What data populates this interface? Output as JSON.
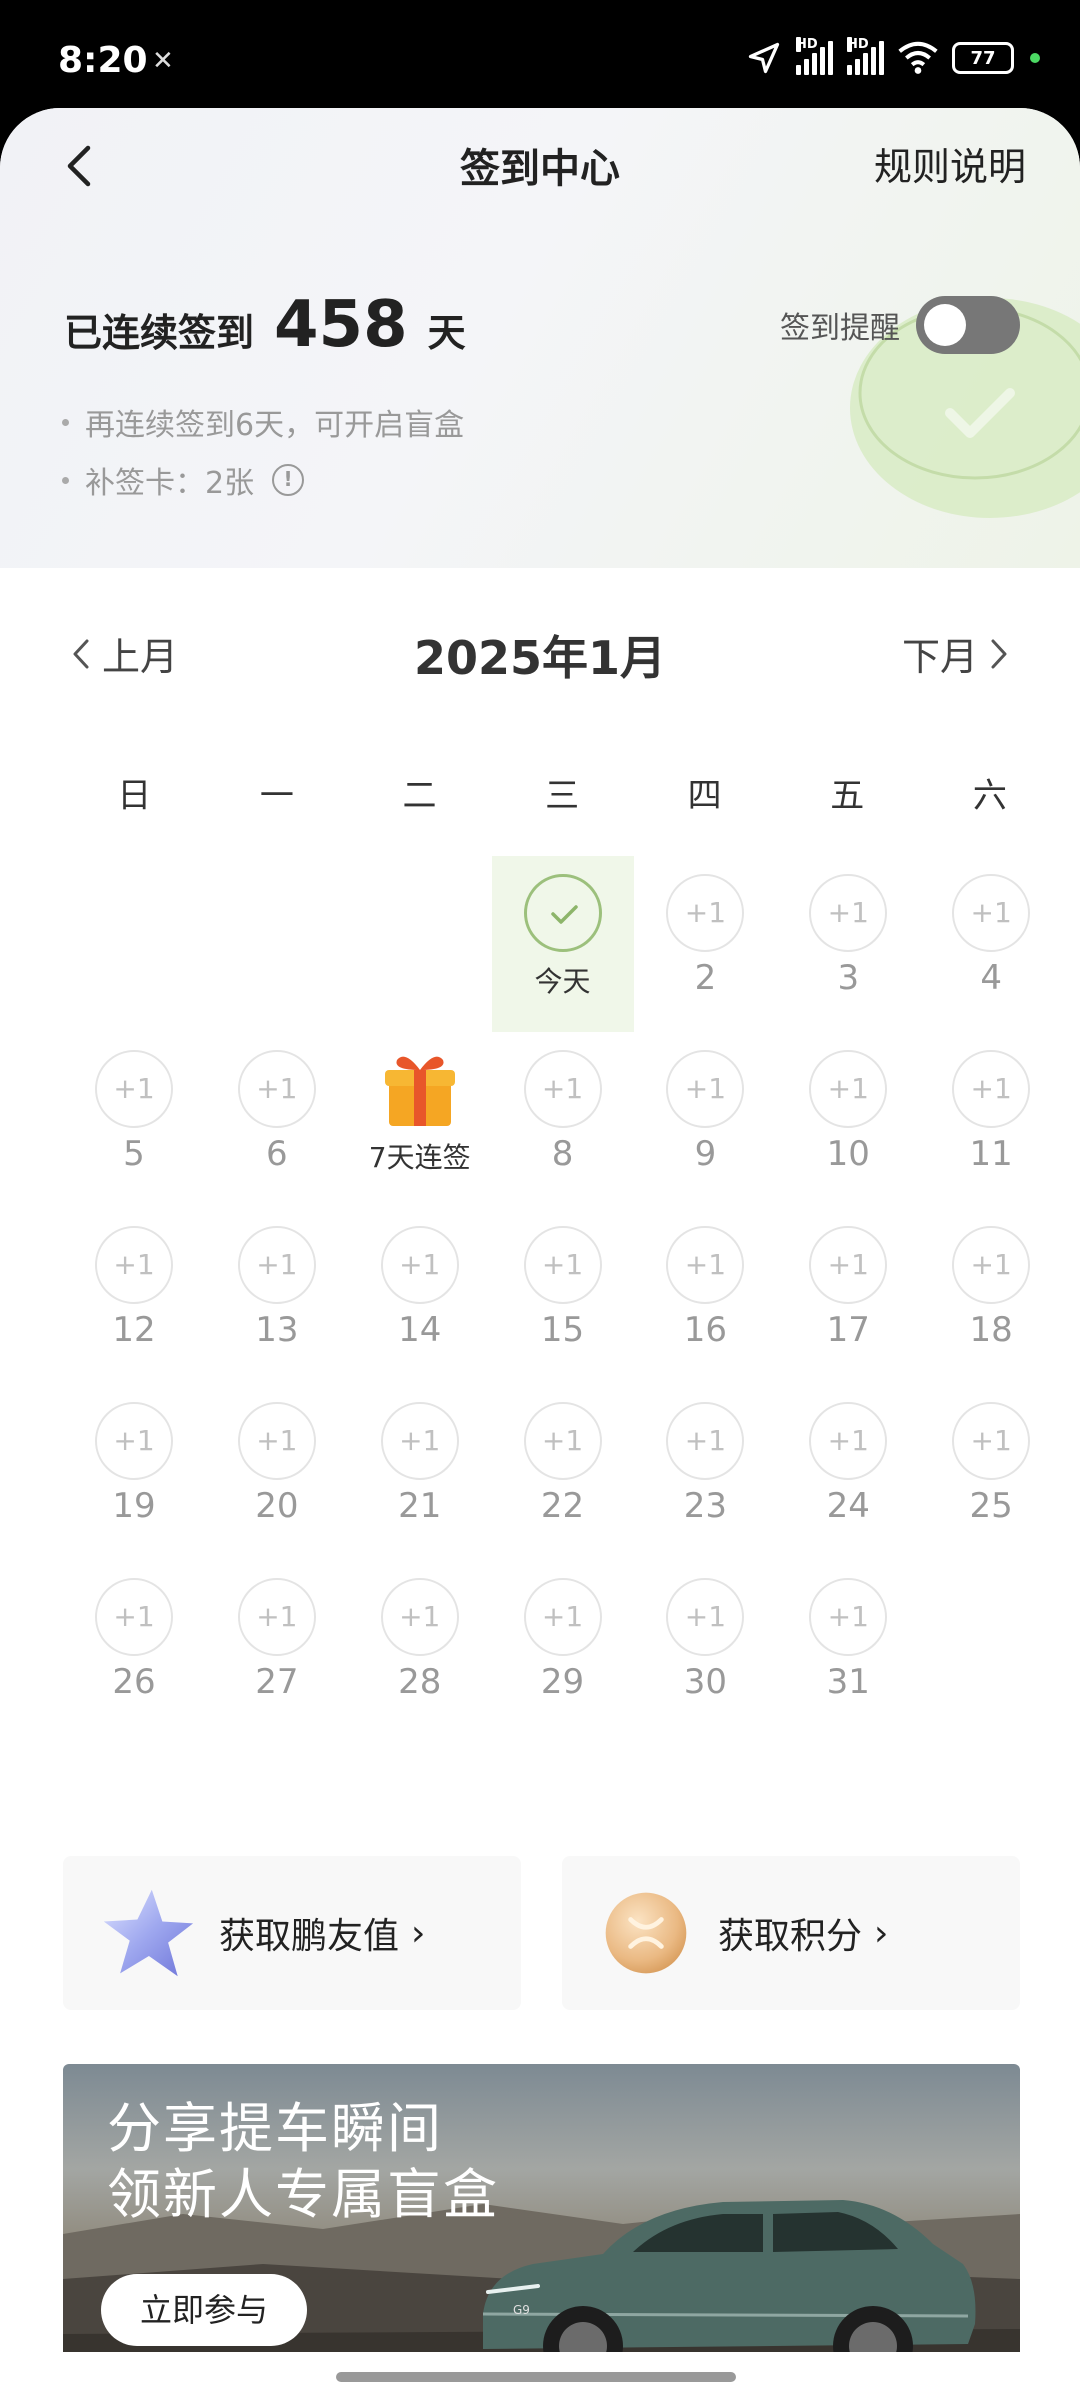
{
  "status": {
    "time": "8:20",
    "battery": "77",
    "hd": "HD"
  },
  "nav": {
    "title": "签到中心",
    "rules": "规则说明"
  },
  "streak": {
    "prefix": "已连续签到",
    "days": "458",
    "suffix": "天"
  },
  "reminder": {
    "label": "签到提醒",
    "enabled": false
  },
  "hints": {
    "blind_box": "再连续签到6天，可开启盲盒",
    "makeup_card": "补签卡：2张"
  },
  "calendar": {
    "prev": "上月",
    "next": "下月",
    "title": "2025年1月",
    "weekdays": [
      "日",
      "一",
      "二",
      "三",
      "四",
      "五",
      "六"
    ],
    "plus_label": "+1",
    "today_label": "今天",
    "gift_label": "7天连签",
    "first_weekday_index": 3,
    "days_in_month": 31,
    "today": 1,
    "gift_day": 7
  },
  "actions": {
    "left": "获取鹏友值",
    "right": "获取积分"
  },
  "banner": {
    "line1": "分享提车瞬间",
    "line2": "领新人专属盲盒",
    "button": "立即参与",
    "car_badge": "G9"
  },
  "colors": {
    "accent_green": "#9cc07c",
    "today_bg": "#f0f7e9",
    "toggle_off": "#777777"
  }
}
